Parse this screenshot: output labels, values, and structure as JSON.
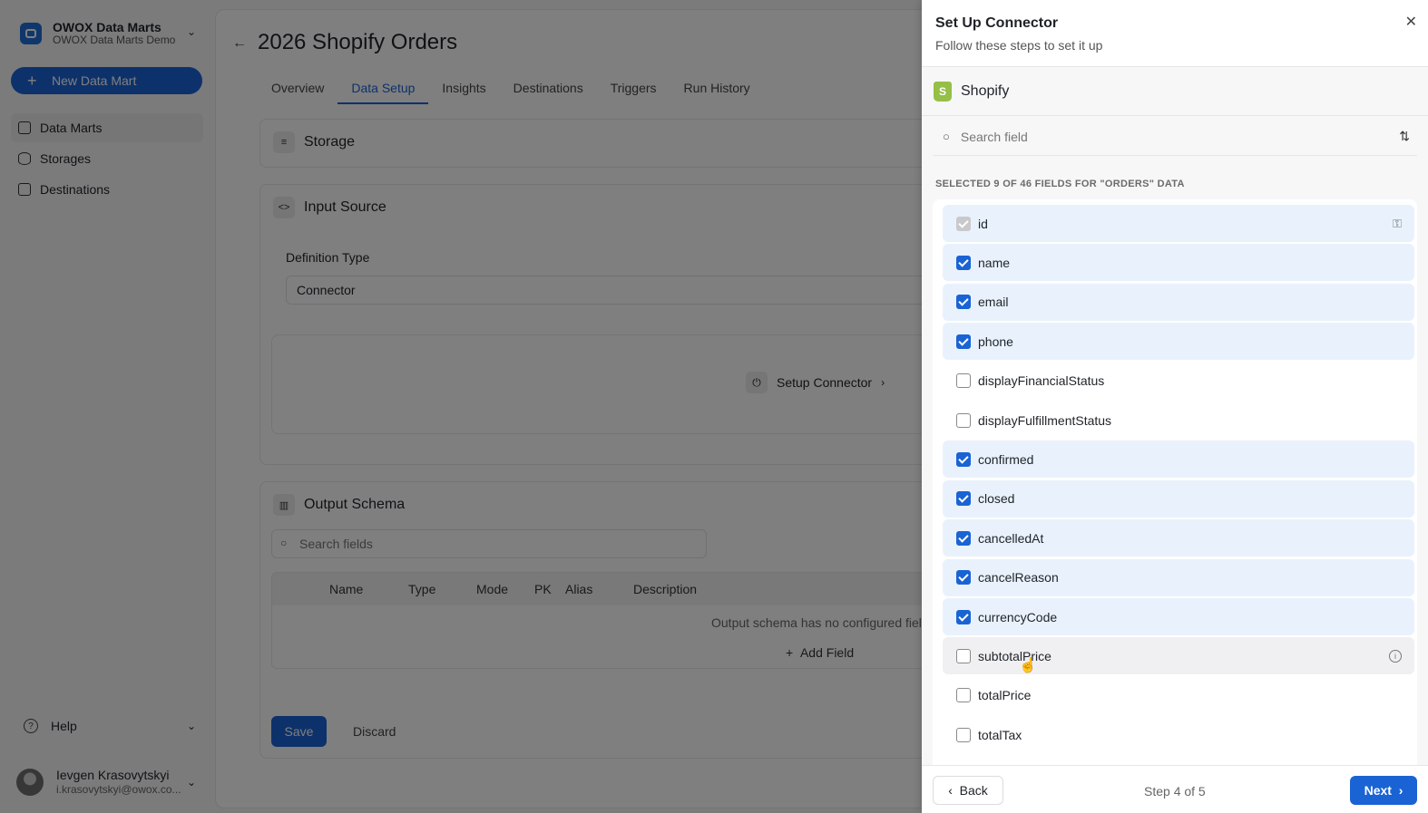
{
  "workspace": {
    "title": "OWOX Data Marts",
    "subtitle": "OWOX Data Marts Demo"
  },
  "sidebar": {
    "new_button": "New Data Mart",
    "items": [
      {
        "label": "Data Marts"
      },
      {
        "label": "Storages"
      },
      {
        "label": "Destinations"
      }
    ],
    "help": "Help",
    "user": {
      "name": "Ievgen Krasovytskyi",
      "email": "i.krasovytskyi@owox.co..."
    }
  },
  "main": {
    "title": "2026 Shopify Orders",
    "tabs": [
      "Overview",
      "Data Setup",
      "Insights",
      "Destinations",
      "Triggers",
      "Run History"
    ],
    "storage_title": "Storage",
    "input_source_title": "Input Source",
    "definition_type_label": "Definition Type",
    "definition_type_value": "Connector",
    "setup_connector": "Setup Connector",
    "output_schema_title": "Output Schema",
    "search_fields_placeholder": "Search fields",
    "columns": [
      "Name",
      "Type",
      "Mode",
      "PK",
      "Alias",
      "Description"
    ],
    "empty_text": "Output schema has no configured fiel",
    "add_field": "Add Field",
    "save": "Save",
    "discard": "Discard"
  },
  "panel": {
    "title": "Set Up Connector",
    "subtitle": "Follow these steps to set it up",
    "connector": "Shopify",
    "search_placeholder": "Search field",
    "selected_label": "SELECTED 9 OF 46 FIELDS FOR \"ORDERS\" DATA",
    "fields": [
      {
        "name": "id",
        "checked": true,
        "disabled": true
      },
      {
        "name": "name",
        "checked": true
      },
      {
        "name": "email",
        "checked": true
      },
      {
        "name": "phone",
        "checked": true
      },
      {
        "name": "displayFinancialStatus",
        "checked": false
      },
      {
        "name": "displayFulfillmentStatus",
        "checked": false
      },
      {
        "name": "confirmed",
        "checked": true
      },
      {
        "name": "closed",
        "checked": true
      },
      {
        "name": "cancelledAt",
        "checked": true
      },
      {
        "name": "cancelReason",
        "checked": true
      },
      {
        "name": "currencyCode",
        "checked": true
      },
      {
        "name": "subtotalPrice",
        "checked": false
      },
      {
        "name": "totalPrice",
        "checked": false
      },
      {
        "name": "totalTax",
        "checked": false
      }
    ],
    "back": "Back",
    "step": "Step 4 of 5",
    "next": "Next"
  },
  "colors": {
    "accent": "#1a63d4",
    "selected_row": "#e9f2fc",
    "shopify": "#95bf47"
  }
}
